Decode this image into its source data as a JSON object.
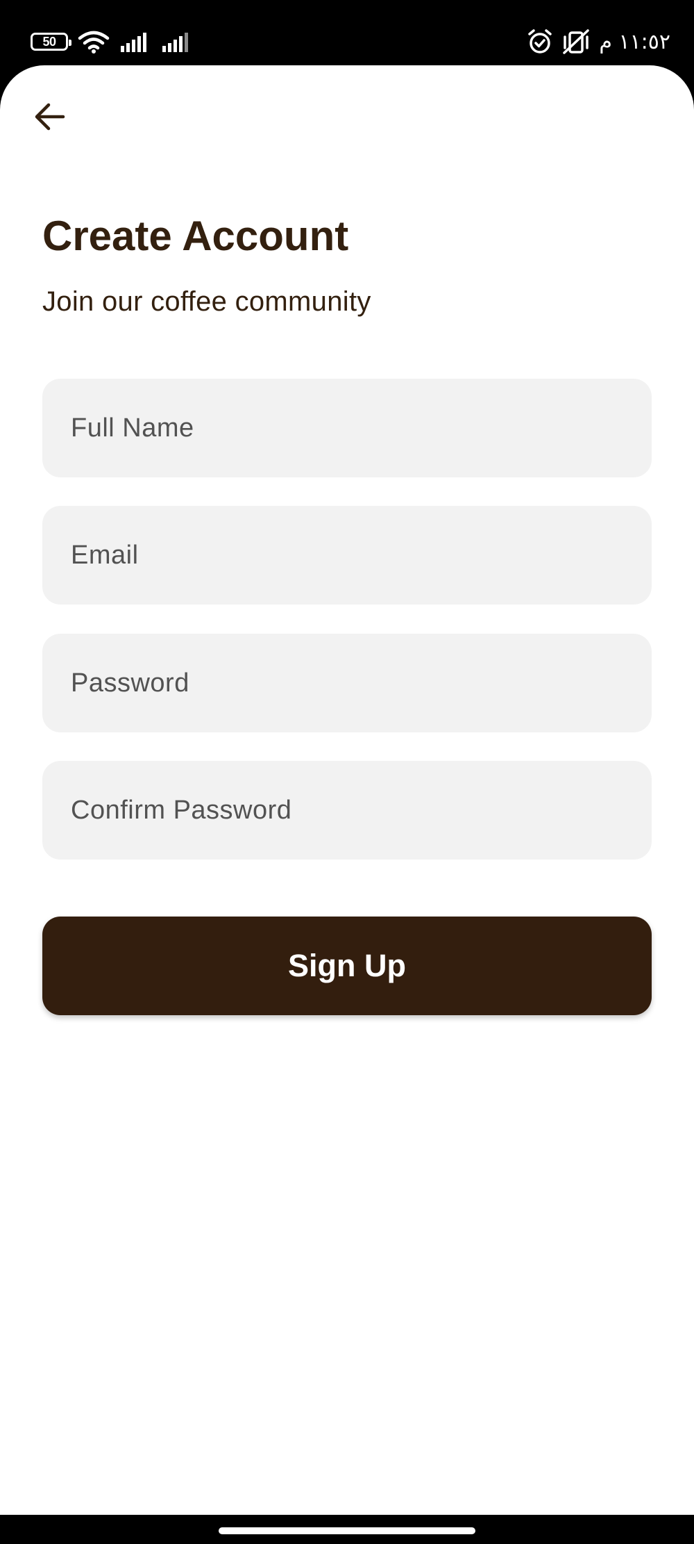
{
  "status_bar": {
    "battery_level": "50",
    "time": "١١:٥٢ م",
    "icons": [
      "battery-icon",
      "wifi-icon",
      "signal-icon",
      "signal-icon-2",
      "alarm-icon",
      "vibrate-off-icon"
    ]
  },
  "header": {
    "back_icon": "arrow-left-icon"
  },
  "main": {
    "title": "Create Account",
    "subtitle": "Join our coffee community"
  },
  "form": {
    "full_name": {
      "placeholder": "Full Name",
      "value": ""
    },
    "email": {
      "placeholder": "Email",
      "value": ""
    },
    "password": {
      "placeholder": "Password",
      "value": ""
    },
    "confirm_password": {
      "placeholder": "Confirm Password",
      "value": ""
    },
    "submit_label": "Sign Up"
  },
  "colors": {
    "brand_dark_brown": "#331e0e",
    "field_background": "#f2f2f2",
    "text_brown": "#33200f",
    "placeholder": "#525252",
    "screen_background": "#ffffff",
    "system_bar": "#000000"
  }
}
